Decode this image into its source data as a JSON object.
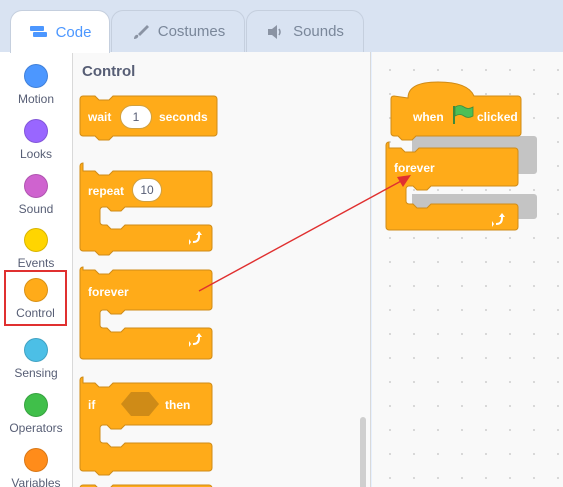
{
  "tabs": [
    {
      "label": "Code",
      "icon": "code-icon",
      "active": true
    },
    {
      "label": "Costumes",
      "icon": "brush-icon",
      "active": false
    },
    {
      "label": "Sounds",
      "icon": "speaker-icon",
      "active": false
    }
  ],
  "categories": [
    {
      "label": "Motion",
      "color": "#4c97ff"
    },
    {
      "label": "Looks",
      "color": "#9966ff"
    },
    {
      "label": "Sound",
      "color": "#cf63cf"
    },
    {
      "label": "Events",
      "color": "#ffd500"
    },
    {
      "label": "Control",
      "color": "#ffab19",
      "selected": true
    },
    {
      "label": "Sensing",
      "color": "#4cbfe6"
    },
    {
      "label": "Operators",
      "color": "#40bf4a"
    },
    {
      "label": "Variables",
      "color": "#ff8c1a"
    }
  ],
  "palette": {
    "title": "Control",
    "wait": {
      "label": "wait",
      "value": "1",
      "unit": "seconds"
    },
    "repeat": {
      "label": "repeat",
      "value": "10"
    },
    "forever": {
      "label": "forever"
    },
    "if": {
      "label": "if",
      "then": "then"
    }
  },
  "script": {
    "hat": {
      "when": "when",
      "clicked": "clicked"
    },
    "forever": {
      "label": "forever"
    }
  },
  "colors": {
    "control": "#ffab19",
    "control_dark": "#cf8b17",
    "ghost": "#c4c4c4",
    "arrow": "#e03030",
    "flag": "#4cbf56"
  }
}
